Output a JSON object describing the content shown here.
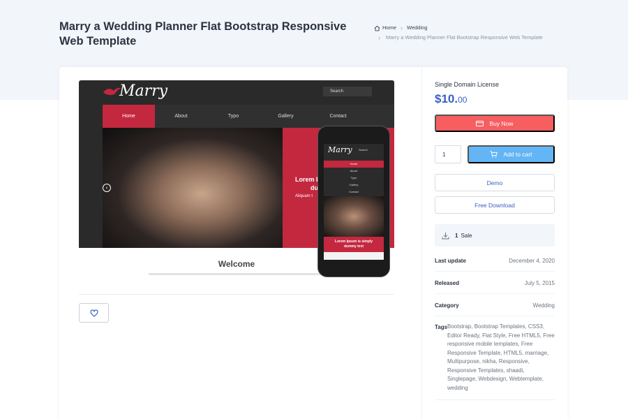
{
  "page": {
    "title": "Marry a Wedding Planner Flat Bootstrap Responsive Web Template"
  },
  "breadcrumb": {
    "home": "Home",
    "category": "Wedding",
    "current": "Marry a Wedding Planner Flat Bootstrap Responsive Web Template"
  },
  "preview": {
    "logo": "Marry",
    "search_label": "Search",
    "nav": [
      "Home",
      "About",
      "Typo",
      "Gallery",
      "Contact"
    ],
    "banner_text_line1": "Lorem I",
    "banner_text_line2": "du",
    "banner_text_line3": "Aliquam t",
    "welcome": "Welcome",
    "phone_nav": [
      "Home",
      "About",
      "Typo",
      "Gallery",
      "Contact"
    ],
    "phone_banner_line1": "Lorem Ipsum is simply",
    "phone_banner_line2": "dummy text",
    "phone_search": "Search"
  },
  "sidebar": {
    "license": "Single Domain License",
    "price_main": "$10.",
    "price_cents": "00",
    "buy_now": "Buy Now",
    "quantity": "1",
    "add_to_cart": "Add to cart",
    "demo": "Demo",
    "free_download": "Free Download",
    "sales_count": "1",
    "sales_label": "Sale",
    "last_update_label": "Last update",
    "last_update_value": "December 4, 2020",
    "released_label": "Released",
    "released_value": "July 5, 2015",
    "category_label": "Category",
    "category_value": "Wedding",
    "tags_label": "Tags",
    "tags_value": "Bootstrap, Bootstrap Templates, CSS3, Editor Ready, Flat Style, Free HTML5, Free responsive mobile templates, Free Responsive Template, HTML5, marriage, Multipurpose, nikha, Responsive, Responsive Templates, shaadi, Singlepage, Webdesign, Webtemplate, wedding"
  },
  "colors": {
    "accent_blue": "#3b5fc4",
    "buy_red": "#f65e60",
    "cart_blue": "#63b5f5",
    "preview_red": "#c3283f"
  },
  "icons": {
    "home": "home-icon",
    "chevron": "chevron-right-icon",
    "card": "credit-card-icon",
    "cart": "cart-icon",
    "download": "download-icon",
    "heart": "heart-icon"
  }
}
